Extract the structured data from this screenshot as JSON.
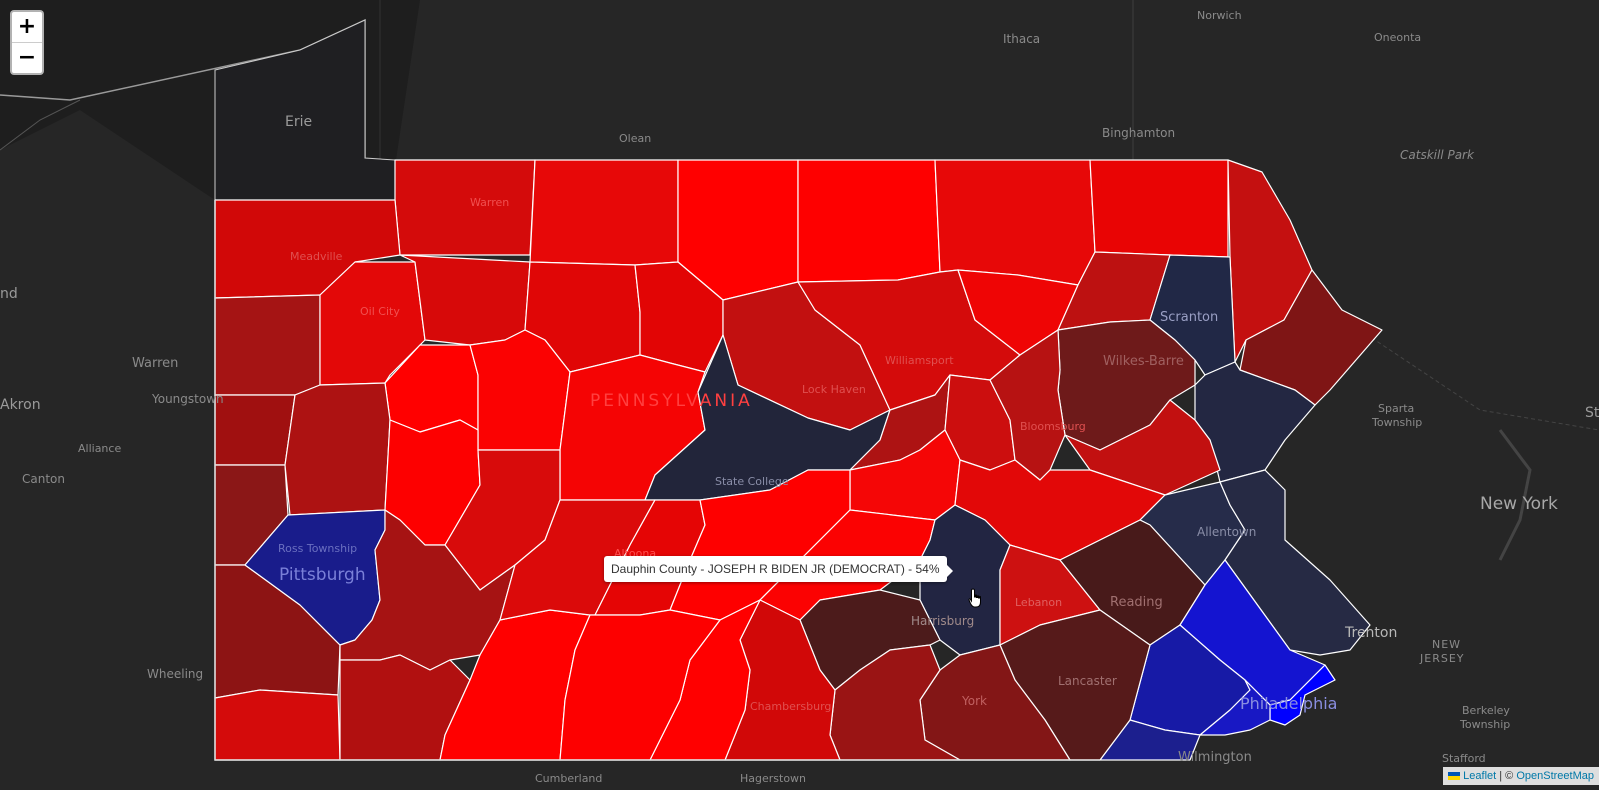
{
  "map": {
    "zoom_in": "+",
    "zoom_out": "−",
    "tooltip": "Dauphin County - JOSEPH R BIDEN JR (DEMOCRAT) - 54%",
    "attribution": {
      "leaflet": "Leaflet",
      "separator": " | © ",
      "osm": "OpenStreetMap"
    },
    "colors": {
      "background": "#262626",
      "rep_strong": "#ff0000",
      "dem_strong": "#0000ff",
      "border": "#ffffff"
    },
    "basemap_labels": {
      "erie": "Erie",
      "ithaca": "Ithaca",
      "norwich": "Norwich",
      "oneonta": "Oneonta",
      "binghamton": "Binghamton",
      "olean": "Olean",
      "catskill": "Catskill Park",
      "warren_oh": "Warren",
      "youngstown": "Youngstown",
      "akron": "Akron",
      "land": "nd",
      "alliance": "Alliance",
      "canton": "Canton",
      "wheeling": "Wheeling",
      "new_york": "New York",
      "sparta": "Sparta",
      "sparta2": "Township",
      "st": "St",
      "new_jersey1": "NEW",
      "new_jersey2": "JERSEY",
      "berkeley": "Berkeley",
      "berkeley2": "Township",
      "trenton": "Trenton",
      "wilmington": "Wilmington",
      "stafford": "Stafford",
      "cumberland": "Cumberland",
      "hagerstown": "Hagerstown"
    },
    "city_labels": {
      "pittsburgh": "Pittsburgh",
      "ross": "Ross Township",
      "scranton": "Scranton",
      "wilkes_barre": "Wilkes-Barre",
      "state_college": "State College",
      "harrisburg": "Harrisburg",
      "lebanon": "Lebanon",
      "reading": "Reading",
      "allentown": "Allentown",
      "lancaster": "Lancaster",
      "york": "York",
      "philadelphia": "Philadelphia",
      "chambersburg": "Chambersburg",
      "lock_haven": "Lock Haven",
      "williamsport": "Williamsport",
      "bloomsburg": "Bloomsburg",
      "meadville": "Meadville",
      "oil_city": "Oil City",
      "warren": "Warren",
      "pennsylvania": "PENNSYLVANIA",
      "altoona": "Altoona"
    }
  }
}
